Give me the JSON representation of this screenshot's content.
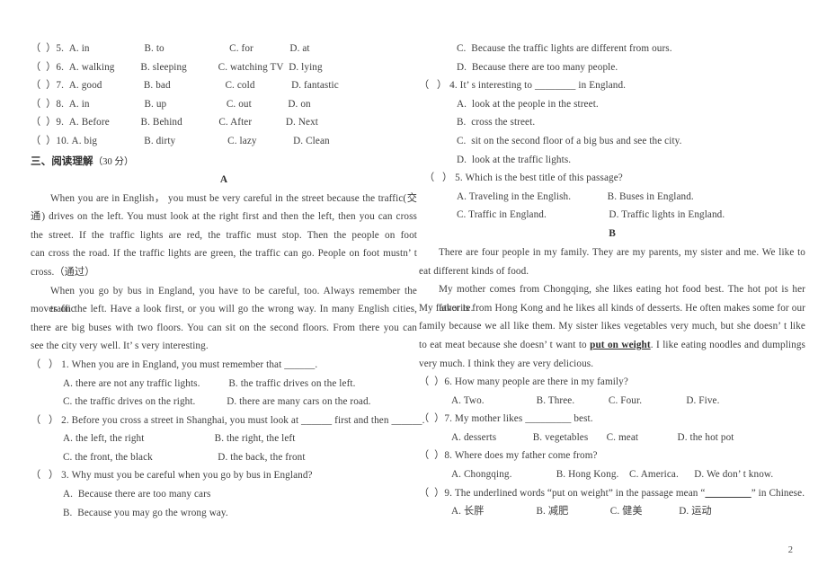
{
  "document": {
    "page_number": "2",
    "section_heading": {
      "label": "三、阅读理解",
      "points": "（30 分）"
    }
  },
  "cloze_tail": {
    "items": [
      {
        "num": "（  ）5.",
        "a": "A. in",
        "b": "B. to",
        "c": "C. for",
        "d": "D. at"
      },
      {
        "num": "（  ）6.",
        "a": "A. walking",
        "b": "B. sleeping",
        "c": "C. watching TV",
        "d": "D. lying"
      },
      {
        "num": "（  ）7.",
        "a": "A. good",
        "b": "B. bad",
        "c": "C. cold",
        "d": "D. fantastic"
      },
      {
        "num": "（  ）8.",
        "a": "A. in",
        "b": "B. up",
        "c": "C. out",
        "d": "D. on"
      },
      {
        "num": "（  ）9.",
        "a": "A. Before",
        "b": "B. Behind",
        "c": "C. After",
        "d": "D. Next"
      },
      {
        "num": "（  ）10.",
        "a": "A. big",
        "b": "B. dirty",
        "c": "C. lazy",
        "d": "D. Clean"
      }
    ],
    "lines": [
      "（  ）5.  A. in                     B. to                         C. for              D. at",
      "（  ）6.  A. walking          B. sleeping            C. watching TV  D. lying",
      "（  ）7.  A. good                B. bad                     C. cold              D. fantastic",
      "（  ）8.  A. in                     B. up                       C. out              D. on",
      "（  ）9.  A. Before            B. Behind              C. After             D. Next",
      "（  ）10. A. big                  B. dirty                    C. lazy              D. Clean"
    ]
  },
  "passage_a": {
    "label": "A",
    "paragraph1": [
      "When you are in English， you must be very careful in the street because the traffic(交",
      "通) drives on the left. You must look at the right first and then the left, then you can cross",
      "the street. If the traffic lights are red, the traffic must stop. Then the people on foot",
      "can cross the road. If the traffic lights are green, the traffic can go. People on foot mustn’ t",
      "cross.（通过）"
    ],
    "paragraph2": [
      "When you go by bus in England, you have to be careful, too. Always remember the traffic",
      "moves on the left. Have a look first, or you will go the wrong way. In many English cities,",
      "there are big buses with two floors. You can sit on the second floors. From there you can",
      "see the city very well. It’ s very interesting."
    ],
    "questions": [
      {
        "stem": "（   ） 1. When you are in England, you must remember that ______.",
        "rows": [
          "A. there are not any traffic lights.           B. the traffic drives on the left.",
          "C. the traffic drives on the right.            D. there are many cars on the road."
        ]
      },
      {
        "stem": "（   ） 2. Before you cross a street in Shanghai, you must look at ______ first and then ______.",
        "rows": [
          "A. the left, the right                           B. the right, the left",
          "C. the front, the black                         D. the back, the front"
        ]
      },
      {
        "stem": "（   ） 3. Why must you be careful when you go by bus in England?",
        "rows": [
          "A.  Because there are too many cars",
          "B.  Because you may go the wrong way."
        ]
      }
    ],
    "questions_cont": [
      "C.  Because the traffic lights are different from ours.",
      "D.  Because there are too many people."
    ],
    "question4": {
      "stem": "（   ） 4. It’ s interesting to ________ in England.",
      "rows": [
        "A.  look at the people in the street.",
        "B.  cross the street.",
        "C.  sit on the second floor of a big bus and see the city.",
        "D.  look at the traffic lights."
      ]
    },
    "question5": {
      "stem": "（   ） 5. Which is the best title of this passage?",
      "rows": [
        "A. Traveling in the English.              B. Buses in England.",
        "C. Traffic in England.                        D. Traffic lights in England."
      ]
    }
  },
  "passage_b": {
    "label": "B",
    "paragraph1": [
      "There are four people in my family. They are my parents, my sister and me. We like to",
      "eat different kinds of food."
    ],
    "paragraph2_pre": [
      "My mother comes from Chongqing, she likes eating hot food best. The hot pot is her favorite.",
      "My father is from Hong Kong and he likes all kinds of desserts. He often makes some for our",
      "family because we all like them. My sister likes vegetables very much, but she doesn’ t like"
    ],
    "underlined_phrase": "put on weight",
    "paragraph2_line4_before": "to eat meat because she doesn’ t want to ",
    "paragraph2_line4_after": ". I like eating noodles and dumplings",
    "paragraph2_post": [
      "very much. I think they are very delicious."
    ],
    "questions": [
      {
        "stem": "（  ）6. How many people are there in my family?",
        "row": "A. Two.                    B. Three.             C. Four.                 D. Five."
      },
      {
        "stem": "（  ）7. My mother likes _________ best.",
        "row": "A. desserts              B. vegetables       C. meat               D. the hot pot"
      },
      {
        "stem": "（  ）8. Where does my father come from?",
        "row": "A. Chongqing.                 B. Hong Kong.    C. America.      D. We don’ t know."
      }
    ],
    "question9": {
      "stem_before": "（  ）9. The underlined words “put on weight” in the passage mean “",
      "blank": "_________",
      "stem_after": "” in Chinese.",
      "row": "A. 长胖                    B. 减肥                C. 健美              D. 运动"
    }
  }
}
